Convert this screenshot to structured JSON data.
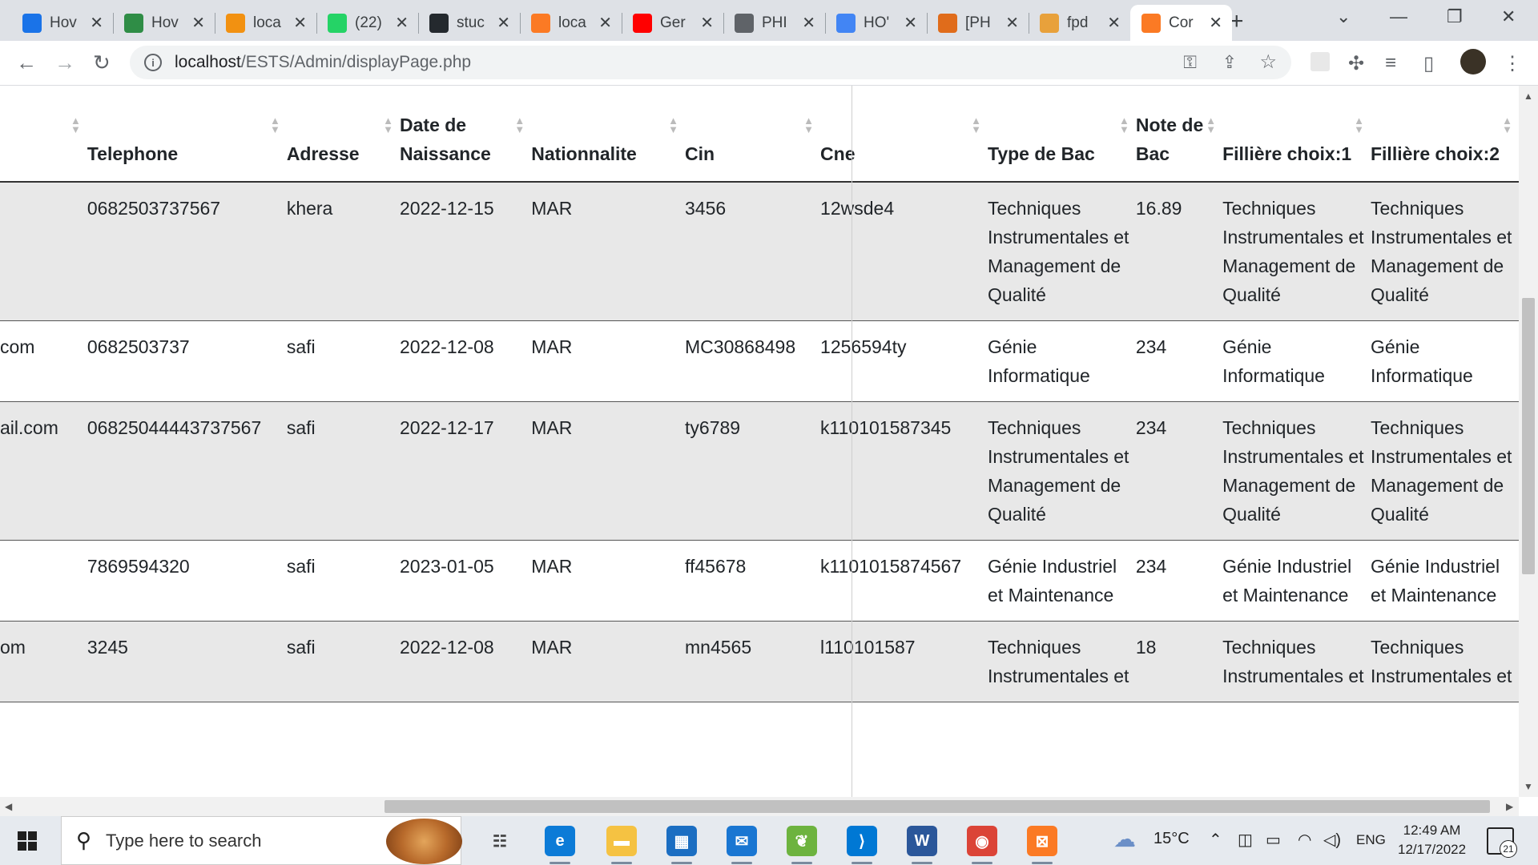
{
  "browser": {
    "tabs": [
      {
        "title": "Hov",
        "icon": "st-icon",
        "color": "#1a73e8"
      },
      {
        "title": "Hov",
        "icon": "geeks-icon",
        "color": "#2f8d46"
      },
      {
        "title": "loca",
        "icon": "phpmyadmin-icon",
        "color": "#f29111"
      },
      {
        "title": "(22)",
        "icon": "whatsapp-icon",
        "color": "#25d366"
      },
      {
        "title": "stuc",
        "icon": "github-icon",
        "color": "#24292e"
      },
      {
        "title": "loca",
        "icon": "xampp-icon",
        "color": "#fb7a24"
      },
      {
        "title": "Ger",
        "icon": "youtube-icon",
        "color": "#ff0000"
      },
      {
        "title": "PHI",
        "icon": "globe-icon",
        "color": "#5f6368"
      },
      {
        "title": "HO'",
        "icon": "google-icon",
        "color": "#4285f4"
      },
      {
        "title": "[PH",
        "icon": "ai-icon",
        "color": "#e06c1b"
      },
      {
        "title": "fpd",
        "icon": "fpdf-icon",
        "color": "#e8a13b"
      },
      {
        "title": "Cor",
        "icon": "xampp-icon",
        "color": "#fb7a24"
      }
    ],
    "new_tab": "+",
    "url_host": "localhost",
    "url_path": "/ESTS/Admin/displayPage.php"
  },
  "table": {
    "headers": [
      "",
      "Telephone",
      "Adresse",
      "Date de Naissance",
      "Nationnalite",
      "Cin",
      "Cne",
      "Type de Bac",
      "Note de Bac",
      "Fillière choix:1",
      "Fillière choix:2"
    ],
    "rows": [
      [
        "",
        "0682503737567",
        "khera",
        "2022-12-15",
        "MAR",
        "3456",
        "12wsde4",
        "Techniques Instrumentales et Management de Qualité",
        "16.89",
        "Techniques Instrumentales et Management de Qualité",
        "Techniques Instrumentales et Management de Qualité"
      ],
      [
        "com",
        "0682503737",
        "safi",
        "2022-12-08",
        "MAR",
        "MC30868498",
        "1256594ty",
        "Génie Informatique",
        "234",
        "Génie Informatique",
        "Génie Informatique"
      ],
      [
        "ail.com",
        "06825044443737567",
        "safi",
        "2022-12-17",
        "MAR",
        "ty6789",
        "k110101587345",
        "Techniques Instrumentales et Management de Qualité",
        "234",
        "Techniques Instrumentales et Management de Qualité",
        "Techniques Instrumentales et Management de Qualité"
      ],
      [
        "",
        "7869594320",
        "safi",
        "2023-01-05",
        "MAR",
        "ff45678",
        "k1101015874567",
        "Génie Industriel et Maintenance",
        "234",
        "Génie Industriel et Maintenance",
        "Génie Industriel et Maintenance"
      ],
      [
        "om",
        "3245",
        "safi",
        "2022-12-08",
        "MAR",
        "mn4565",
        "l110101587",
        "Techniques Instrumentales et",
        "18",
        "Techniques Instrumentales et",
        "Techniques Instrumentales et"
      ]
    ]
  },
  "taskbar": {
    "search_placeholder": "Type here to search",
    "apps": [
      {
        "name": "task-view-icon",
        "color": "#444"
      },
      {
        "name": "edge-icon",
        "color": "#0c7bd7"
      },
      {
        "name": "file-explorer-icon",
        "color": "#f5c242"
      },
      {
        "name": "store-icon",
        "color": "#1b6ec2"
      },
      {
        "name": "mail-icon",
        "color": "#1976d2"
      },
      {
        "name": "spring-icon",
        "color": "#6db33f"
      },
      {
        "name": "vscode-icon",
        "color": "#0078d4"
      },
      {
        "name": "word-icon",
        "color": "#2b579a"
      },
      {
        "name": "chrome-icon",
        "color": "#db4437"
      },
      {
        "name": "xampp-icon",
        "color": "#fb7a24"
      }
    ],
    "weather": "15°C",
    "language": "ENG",
    "time": "12:49 AM",
    "date": "12/17/2022",
    "notifications": "21"
  }
}
